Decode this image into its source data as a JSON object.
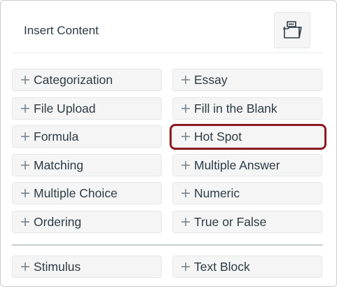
{
  "header": {
    "title": "Insert Content",
    "bank_button_icon": "item-bank-folder-icon"
  },
  "items": [
    {
      "label": "Categorization"
    },
    {
      "label": "Essay"
    },
    {
      "label": "File Upload"
    },
    {
      "label": "Fill in the Blank"
    },
    {
      "label": "Formula"
    },
    {
      "label": "Hot Spot",
      "highlighted": true
    },
    {
      "label": "Matching"
    },
    {
      "label": "Multiple Answer"
    },
    {
      "label": "Multiple Choice"
    },
    {
      "label": "Numeric"
    },
    {
      "label": "Ordering"
    },
    {
      "label": "True or False"
    }
  ],
  "secondary_items": [
    {
      "label": "Stimulus"
    },
    {
      "label": "Text Block"
    }
  ],
  "colors": {
    "text": "#2d3b45",
    "tile_background": "#f5f5f5",
    "highlight_border": "#8b1a22"
  }
}
